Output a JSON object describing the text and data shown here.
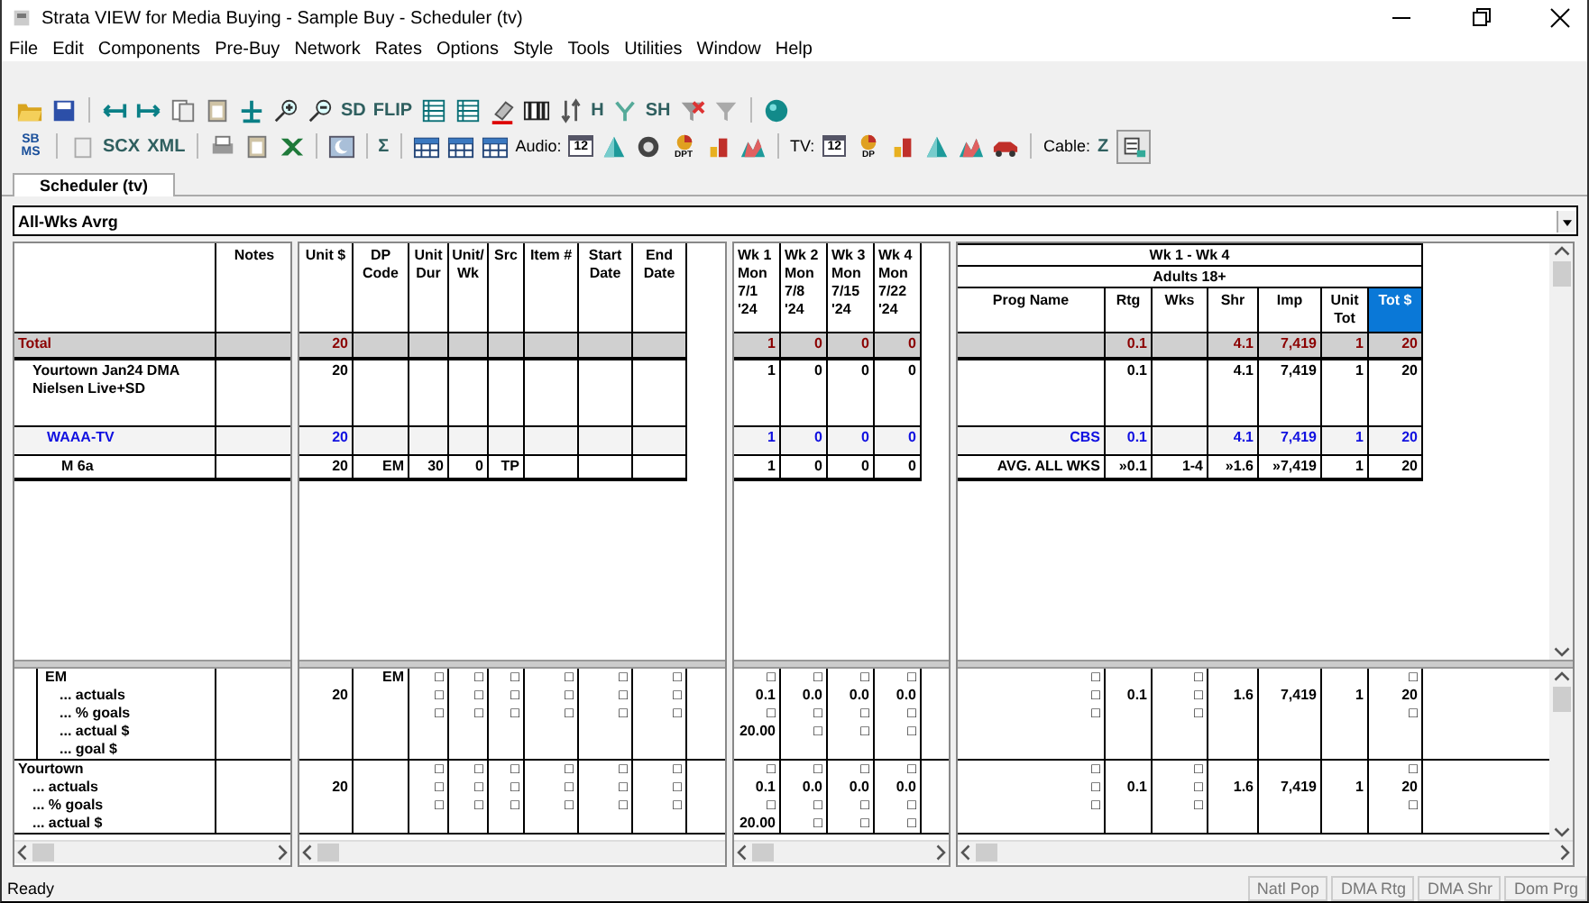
{
  "window": {
    "title": "Strata VIEW for Media Buying - Sample Buy - Scheduler (tv)"
  },
  "menu": [
    "File",
    "Edit",
    "Components",
    "Pre-Buy",
    "Network",
    "Rates",
    "Options",
    "Style",
    "Tools",
    "Utilities",
    "Window",
    "Help"
  ],
  "toolbar_1": [
    {
      "kind": "folder"
    },
    {
      "kind": "save"
    },
    {
      "kind": "sep"
    },
    {
      "kind": "arrow-left"
    },
    {
      "kind": "arrow-right"
    },
    {
      "kind": "pages"
    },
    {
      "kind": "clipboard"
    },
    {
      "kind": "split"
    },
    {
      "kind": "zoom-in"
    },
    {
      "kind": "zoom-out"
    },
    {
      "kind": "text",
      "text": "SD"
    },
    {
      "kind": "text",
      "text": "FLIP"
    },
    {
      "kind": "grid"
    },
    {
      "kind": "grid"
    },
    {
      "kind": "eraser"
    },
    {
      "kind": "columns"
    },
    {
      "kind": "sort"
    },
    {
      "kind": "text",
      "text": "H"
    },
    {
      "kind": "filter-green"
    },
    {
      "kind": "text",
      "text": "SH"
    },
    {
      "kind": "filter-x"
    },
    {
      "kind": "filter"
    },
    {
      "kind": "sep"
    },
    {
      "kind": "help"
    }
  ],
  "toolbar_2": [
    {
      "kind": "logo",
      "text": "SB MS"
    },
    {
      "kind": "sep"
    },
    {
      "kind": "doc"
    },
    {
      "kind": "text",
      "text": "SCX"
    },
    {
      "kind": "text",
      "text": "XML"
    },
    {
      "kind": "sep"
    },
    {
      "kind": "printer"
    },
    {
      "kind": "clipboard"
    },
    {
      "kind": "excel"
    },
    {
      "kind": "sep"
    },
    {
      "kind": "moon"
    },
    {
      "kind": "sep"
    },
    {
      "kind": "text",
      "text": "Σ"
    },
    {
      "kind": "sep"
    },
    {
      "kind": "table"
    },
    {
      "kind": "table"
    },
    {
      "kind": "table"
    },
    {
      "kind": "label",
      "text": "Audio:"
    },
    {
      "kind": "calendar",
      "text": "12"
    },
    {
      "kind": "pyramid"
    },
    {
      "kind": "clock"
    },
    {
      "kind": "pie",
      "text": "DPT"
    },
    {
      "kind": "bar-chart"
    },
    {
      "kind": "mountain"
    },
    {
      "kind": "sep"
    },
    {
      "kind": "label",
      "text": "TV:"
    },
    {
      "kind": "calendar",
      "text": "12"
    },
    {
      "kind": "pie",
      "text": "DP"
    },
    {
      "kind": "bar-chart"
    },
    {
      "kind": "pyramid"
    },
    {
      "kind": "mountain"
    },
    {
      "kind": "car"
    },
    {
      "kind": "sep"
    },
    {
      "kind": "label",
      "text": "Cable:"
    },
    {
      "kind": "text",
      "text": "Z"
    },
    {
      "kind": "pressed"
    }
  ],
  "tabs": [
    {
      "label": "Scheduler (tv)",
      "selected": true
    }
  ],
  "view_selector": {
    "value": "All-Wks Avrg"
  },
  "grid": {
    "notes_header": "Notes",
    "detail_columns": [
      "Unit $",
      "DP\nCode",
      "Unit\nDur",
      "Unit/\nWk",
      "Src",
      "Item #",
      "Start\nDate",
      "End\nDate"
    ],
    "week_columns": [
      "Wk 1\nMon\n7/1\n'24",
      "Wk 2\nMon\n7/8\n'24",
      "Wk 3\nMon\n7/15\n'24",
      "Wk 4\nMon\n7/22\n'24"
    ],
    "summary": {
      "period": "Wk 1 - Wk 4",
      "demo": "Adults 18+",
      "columns": [
        {
          "label": "Prog Name",
          "selected": false
        },
        {
          "label": "Rtg",
          "selected": false
        },
        {
          "label": "Wks",
          "selected": false
        },
        {
          "label": "Shr",
          "selected": false
        },
        {
          "label": "Imp",
          "selected": false
        },
        {
          "label": "Unit\nTot",
          "selected": false
        },
        {
          "label": "Tot $",
          "selected": true
        }
      ]
    },
    "rows": [
      {
        "kind": "total",
        "name": "Total",
        "detail": {
          "unit_cost": "20"
        },
        "weeks": [
          "1",
          "0",
          "0",
          "0"
        ],
        "summary": {
          "rtg": "0.1",
          "shr": "4.1",
          "imp": "7,419",
          "unit_tot": "1",
          "tot_cost": "20"
        },
        "children": [
          {
            "kind": "market",
            "name": "Yourtown Jan24 DMA Nielsen Live+SD",
            "detail": {
              "unit_cost": "20"
            },
            "weeks": [
              "1",
              "0",
              "0",
              "0"
            ],
            "summary": {
              "rtg": "0.1",
              "shr": "4.1",
              "imp": "7,419",
              "unit_tot": "1",
              "tot_cost": "20"
            },
            "children": [
              {
                "kind": "station",
                "name": "WAAA-TV",
                "detail": {
                  "unit_cost": "20"
                },
                "weeks": [
                  "1",
                  "0",
                  "0",
                  "0"
                ],
                "summary": {
                  "prog_name": "CBS",
                  "rtg": "0.1",
                  "shr": "4.1",
                  "imp": "7,419",
                  "unit_tot": "1",
                  "tot_cost": "20"
                },
                "children": [
                  {
                    "kind": "line",
                    "name": "M 6a",
                    "detail": {
                      "unit_cost": "20",
                      "dp_code": "EM",
                      "unit_dur": "30",
                      "units_wk": "0",
                      "src": "TP"
                    },
                    "weeks": [
                      "1",
                      "0",
                      "0",
                      "0"
                    ],
                    "summary": {
                      "prog_name": "AVG. ALL WKS",
                      "rtg": "»0.1",
                      "wks": "1-4",
                      "shr": "»1.6",
                      "imp": "»7,419",
                      "unit_tot": "1",
                      "tot_cost": "20"
                    }
                  }
                ]
              }
            ]
          }
        ]
      }
    ],
    "goal_groups": [
      {
        "kind": "daypart",
        "lines": [
          {
            "name": "EM",
            "detail": {
              "dp_code": "EM",
              "unit_dur": "□",
              "units_wk": "□",
              "src": "□",
              "item": "□",
              "start_date": "□",
              "end_date": "□"
            },
            "weeks": [
              "□",
              "□",
              "□",
              "□"
            ],
            "summary": {
              "prog_name": "□",
              "wks": "□",
              "tot_cost": "□"
            }
          },
          {
            "name": "... actuals",
            "detail": {
              "unit_cost": "20",
              "unit_dur": "□",
              "units_wk": "□",
              "src": "□",
              "item": "□",
              "start_date": "□",
              "end_date": "□"
            },
            "weeks": [
              "0.1",
              "0.0",
              "0.0",
              "0.0"
            ],
            "summary": {
              "prog_name": "□",
              "rtg": "0.1",
              "wks": "□",
              "shr": "1.6",
              "imp": "7,419",
              "unit_tot": "1",
              "tot_cost": "20"
            }
          },
          {
            "name": "... % goals",
            "detail": {
              "unit_dur": "□",
              "units_wk": "□",
              "src": "□",
              "item": "□",
              "start_date": "□",
              "end_date": "□"
            },
            "weeks": [
              "□",
              "□",
              "□",
              "□"
            ],
            "summary": {
              "prog_name": "□",
              "wks": "□",
              "tot_cost": "□"
            }
          },
          {
            "name": "... actual $",
            "weeks": [
              "20.00",
              "□",
              "□",
              "□"
            ]
          },
          {
            "name": "... goal $"
          }
        ]
      },
      {
        "kind": "market",
        "lines": [
          {
            "name": "Yourtown",
            "detail": {
              "unit_dur": "□",
              "units_wk": "□",
              "src": "□",
              "item": "□",
              "start_date": "□",
              "end_date": "□"
            },
            "weeks": [
              "□",
              "□",
              "□",
              "□"
            ],
            "summary": {
              "prog_name": "□",
              "wks": "□",
              "tot_cost": "□"
            }
          },
          {
            "name": "... actuals",
            "detail": {
              "unit_cost": "20",
              "unit_dur": "□",
              "units_wk": "□",
              "src": "□",
              "item": "□",
              "start_date": "□",
              "end_date": "□"
            },
            "weeks": [
              "0.1",
              "0.0",
              "0.0",
              "0.0"
            ],
            "summary": {
              "prog_name": "□",
              "rtg": "0.1",
              "wks": "□",
              "shr": "1.6",
              "imp": "7,419",
              "unit_tot": "1",
              "tot_cost": "20"
            }
          },
          {
            "name": "... % goals",
            "detail": {
              "unit_dur": "□",
              "units_wk": "□",
              "src": "□",
              "item": "□",
              "start_date": "□",
              "end_date": "□"
            },
            "weeks": [
              "□",
              "□",
              "□",
              "□"
            ],
            "summary": {
              "prog_name": "□",
              "wks": "□",
              "tot_cost": "□"
            }
          },
          {
            "name": "... actual $",
            "weeks": [
              "20.00",
              "□",
              "□",
              "□"
            ]
          }
        ]
      }
    ]
  },
  "status_bar": {
    "text": "Ready",
    "panels": [
      {
        "label": "Natl Pop",
        "disabled": true
      },
      {
        "label": "DMA Rtg",
        "disabled": true
      },
      {
        "label": "DMA Shr",
        "disabled": true
      },
      {
        "label": "Dom Prg",
        "disabled": true
      }
    ]
  }
}
